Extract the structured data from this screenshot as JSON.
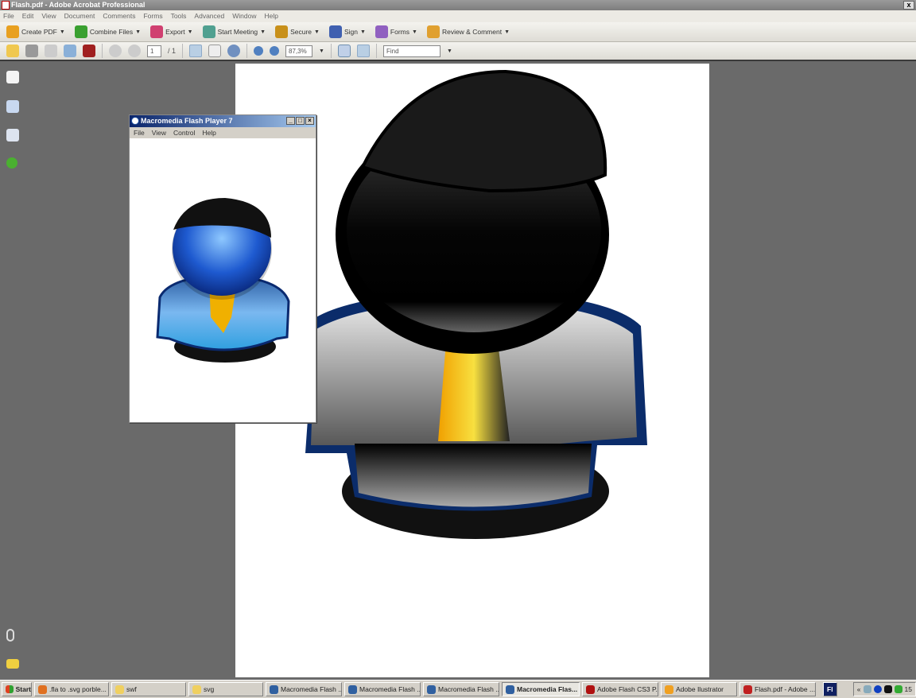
{
  "window": {
    "title": "Flash.pdf - Adobe Acrobat Professional",
    "close": "x"
  },
  "menu": [
    "File",
    "Edit",
    "View",
    "Document",
    "Comments",
    "Forms",
    "Tools",
    "Advanced",
    "Window",
    "Help"
  ],
  "toolbar1": [
    {
      "label": "Create PDF",
      "icon": "create-pdf-icon",
      "color": "#e8a020"
    },
    {
      "label": "Combine Files",
      "icon": "combine-files-icon",
      "color": "#3aa030"
    },
    {
      "label": "Export",
      "icon": "export-icon",
      "color": "#d04070"
    },
    {
      "label": "Start Meeting",
      "icon": "meeting-icon",
      "color": "#50a090"
    },
    {
      "label": "Secure",
      "icon": "lock-icon",
      "color": "#c8901a"
    },
    {
      "label": "Sign",
      "icon": "pen-icon",
      "color": "#4060b0"
    },
    {
      "label": "Forms",
      "icon": "forms-icon",
      "color": "#9060c0"
    },
    {
      "label": "Review & Comment",
      "icon": "review-icon",
      "color": "#e0a030"
    }
  ],
  "toolbar2": {
    "page_current": "1",
    "page_total": "/ 1",
    "zoom": "87,3%",
    "find_placeholder": "Find"
  },
  "flash_window": {
    "title": "Macromedia Flash Player 7",
    "menu": [
      "File",
      "View",
      "Control",
      "Help"
    ]
  },
  "taskbar": {
    "start": "Start",
    "tasks": [
      {
        "label": ".fla to .svg porble...",
        "icon": "firefox-icon",
        "color": "#e07020",
        "active": false
      },
      {
        "label": "swf",
        "icon": "folder-icon",
        "color": "#f0d060",
        "active": false
      },
      {
        "label": "svg",
        "icon": "folder-icon",
        "color": "#f0d060",
        "active": false
      },
      {
        "label": "Macromedia Flash ...",
        "icon": "flash-player-icon",
        "color": "#3060a0",
        "active": false
      },
      {
        "label": "Macromedia Flash ...",
        "icon": "flash-player-icon",
        "color": "#3060a0",
        "active": false
      },
      {
        "label": "Macromedia Flash ...",
        "icon": "flash-player-icon",
        "color": "#3060a0",
        "active": false
      },
      {
        "label": "Macromedia Flas...",
        "icon": "flash-player-icon",
        "color": "#3060a0",
        "active": true
      },
      {
        "label": "Adobe Flash CS3 P...",
        "icon": "flash-cs3-icon",
        "color": "#b01010",
        "active": false
      },
      {
        "label": "Adobe Ilustrator",
        "icon": "illustrator-icon",
        "color": "#f0a020",
        "active": false
      },
      {
        "label": "Flash.pdf - Adobe ...",
        "icon": "pdf-icon",
        "color": "#c02020",
        "active": false
      }
    ],
    "quicklaunch": "Fl",
    "tray_expand": "«",
    "clock": "15"
  }
}
